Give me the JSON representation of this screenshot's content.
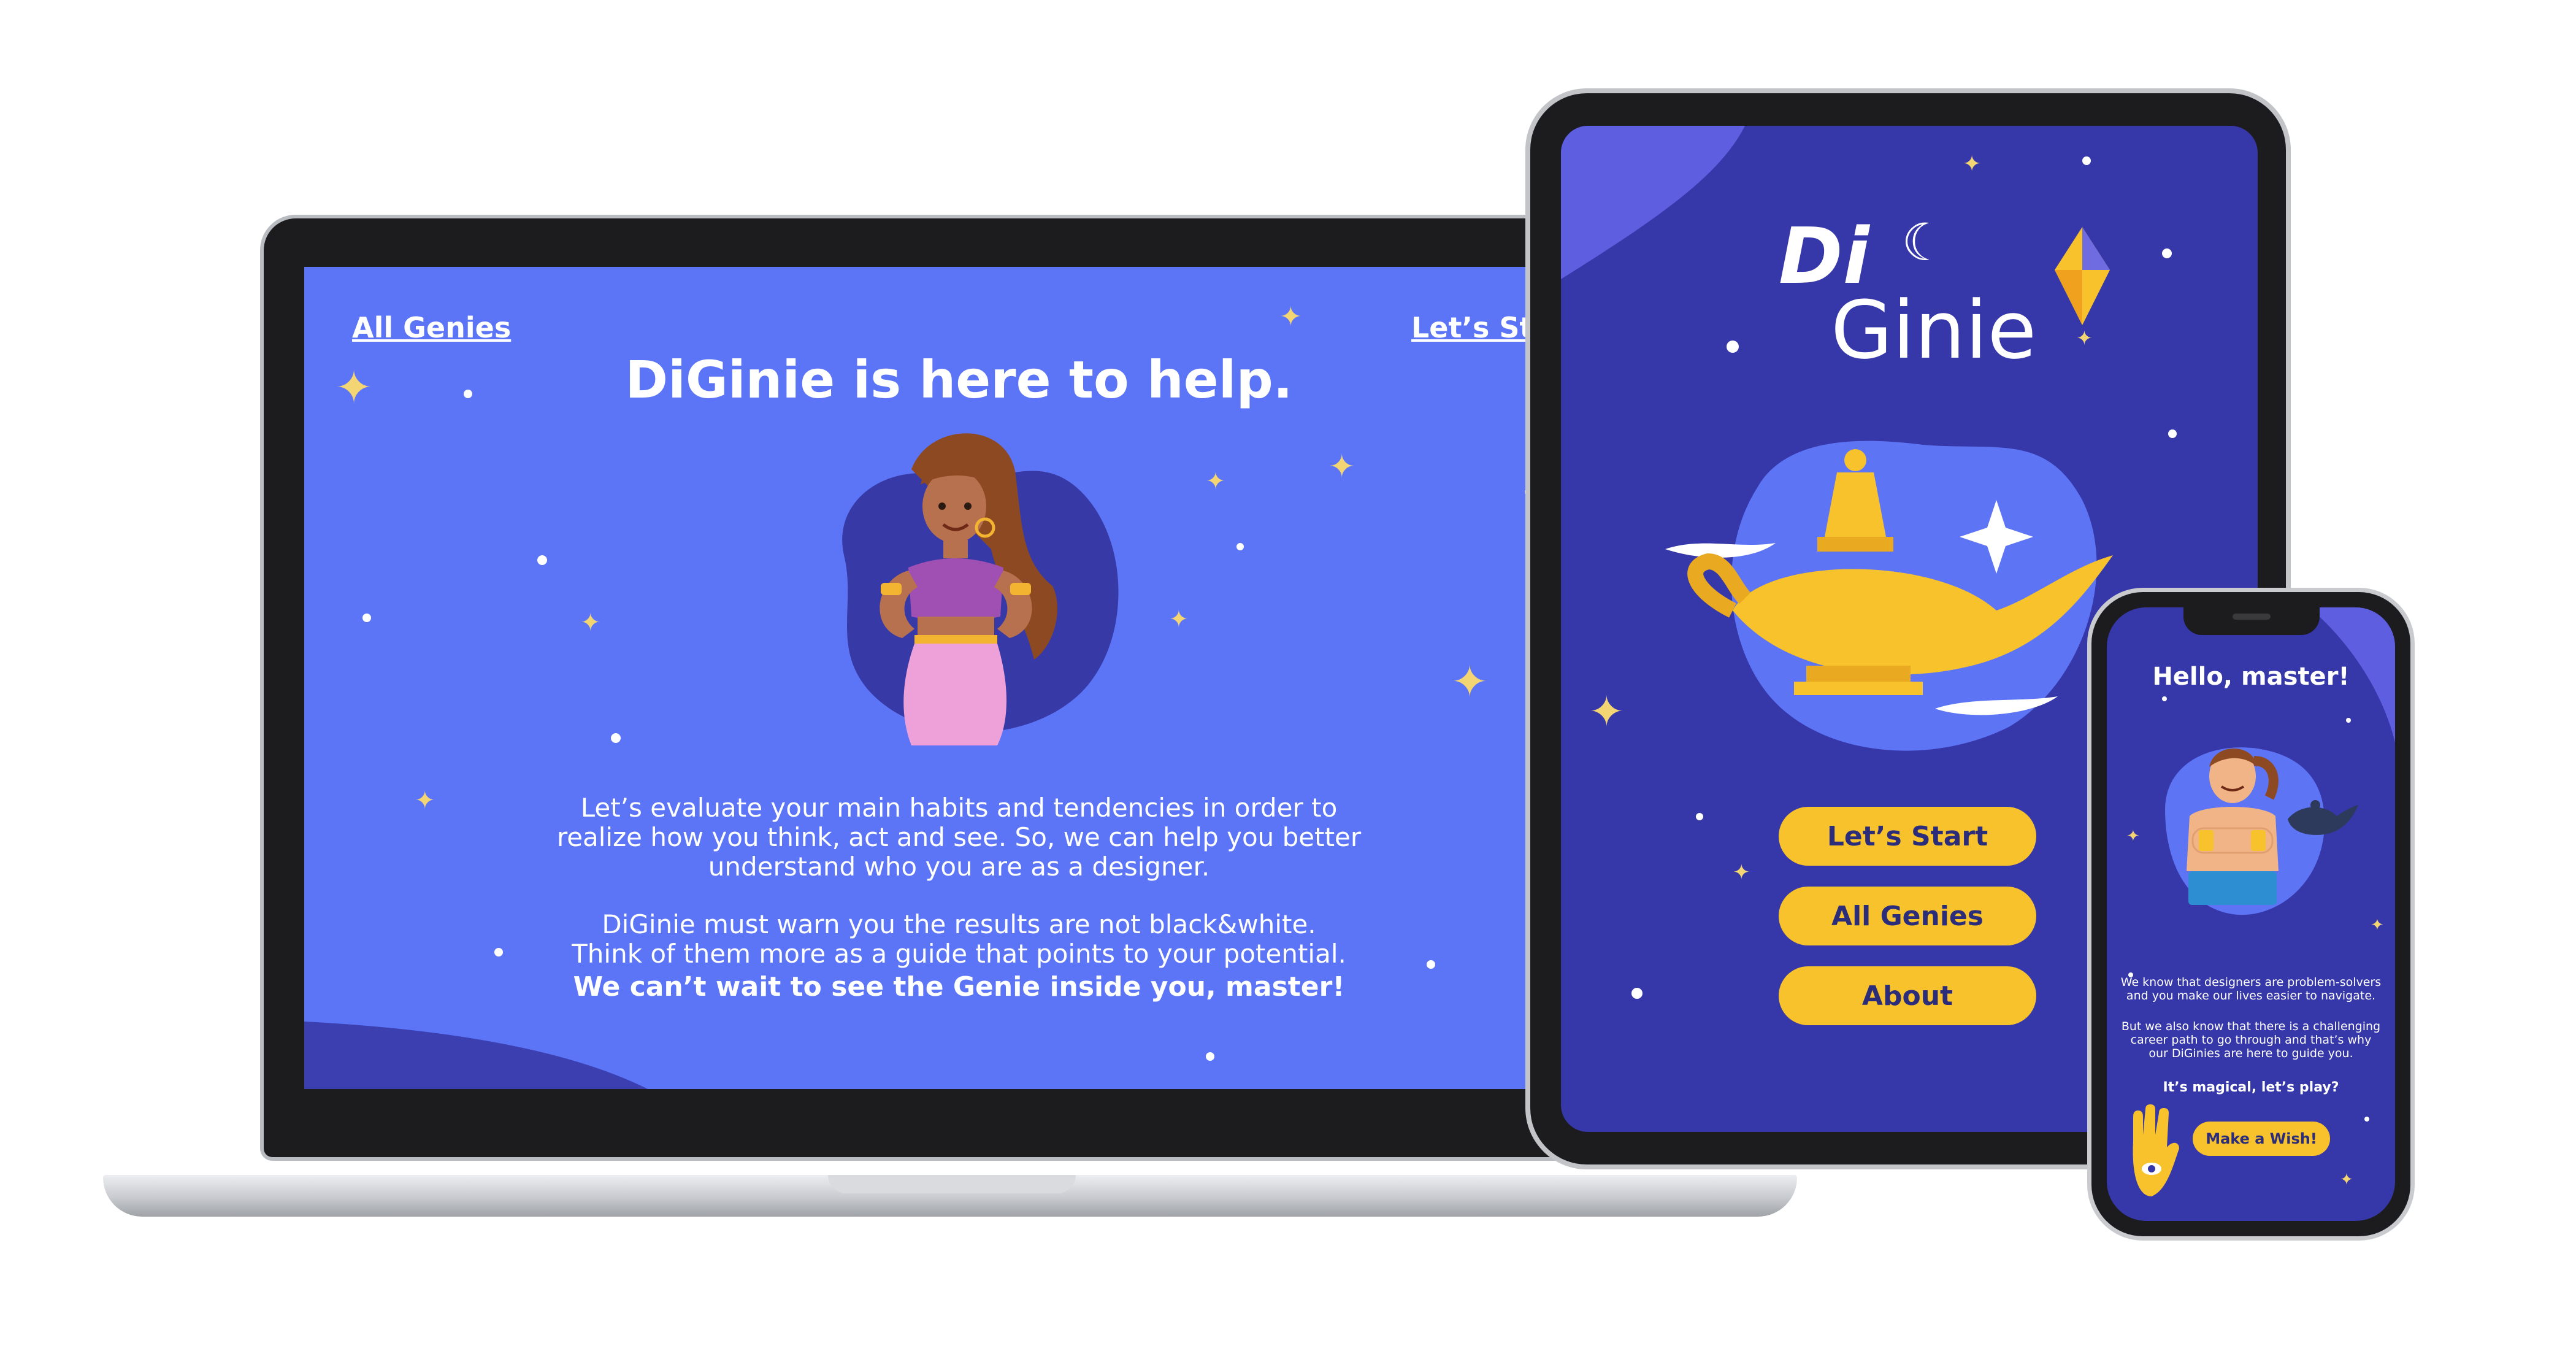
{
  "laptop": {
    "nav_left": "All Genies",
    "nav_right": "Let’s Start",
    "title": "DiGinie is here to help.",
    "para1": [
      "Let’s evaluate your main habits and tendencies in order to",
      "realize how you think, act and see. So, we can help you better",
      "understand who you are as a designer."
    ],
    "para2": [
      "DiGinie must warn you the results are not black&white.",
      "Think of them more as a guide that points to your potential."
    ],
    "closing": "We can’t wait to see the Genie inside you, master!"
  },
  "tablet": {
    "logo_line1": "Di",
    "logo_line2": "Ginie",
    "buttons": [
      "Let’s Start",
      "All Genies",
      "About"
    ]
  },
  "phone": {
    "greeting": "Hello, master!",
    "para1": [
      "We know that designers are problem-solvers",
      "and you make our lives easier to navigate."
    ],
    "para2": [
      "But we also know that there is a challenging",
      "career path to go through and that’s why",
      "our DiGinies are here to guide you."
    ],
    "prompt": "It’s magical, let’s play?",
    "cta": "Make a Wish!"
  },
  "colors": {
    "laptop_bg": "#5c75f7",
    "app_bg": "#3637a8",
    "accent_yellow": "#f8c22c",
    "blob_light": "#5d74f5",
    "blob_dark": "#3739a6"
  }
}
